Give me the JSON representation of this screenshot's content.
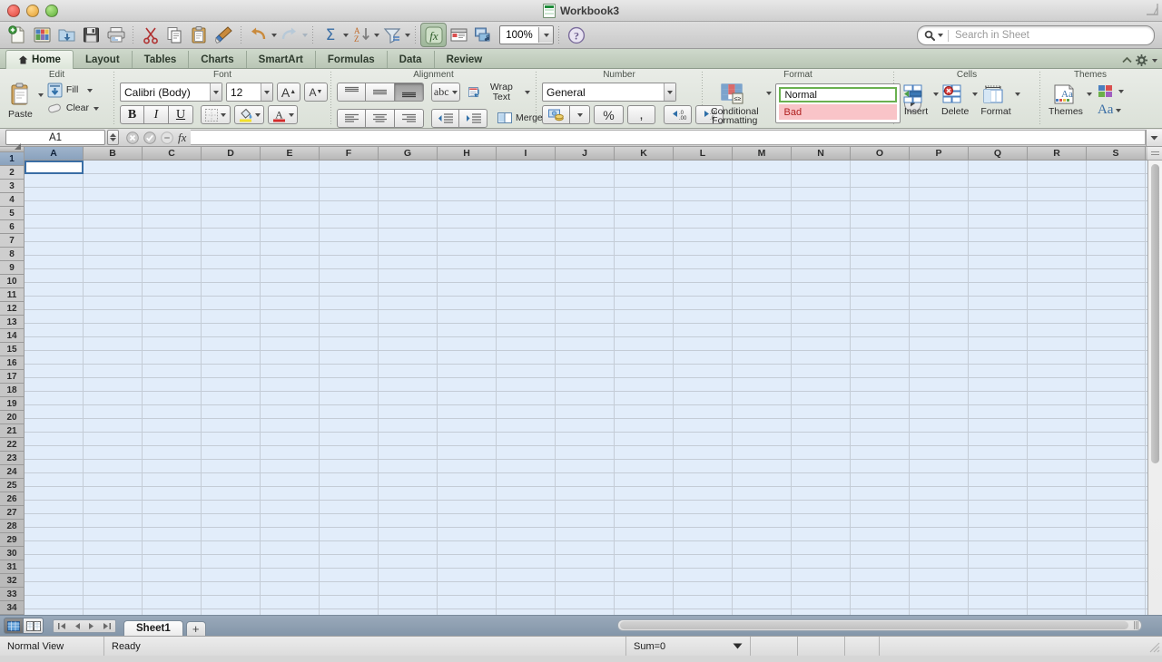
{
  "window": {
    "title": "Workbook3",
    "doc_icon": "spreadsheet-icon",
    "traffic_lights": [
      "close",
      "minimize",
      "zoom"
    ]
  },
  "toolbar": {
    "items": [
      {
        "name": "new-workbook",
        "icon": "new-document-icon",
        "label": "New"
      },
      {
        "name": "open-recent",
        "icon": "open-gallery-icon",
        "label": "Open"
      },
      {
        "name": "open",
        "icon": "open-folder-icon",
        "label": "Open"
      },
      {
        "name": "save",
        "icon": "save-disk-icon",
        "label": "Save"
      },
      {
        "name": "print",
        "icon": "printer-icon",
        "label": "Print"
      },
      {
        "name": "cut",
        "icon": "scissors-icon",
        "label": "Cut"
      },
      {
        "name": "copy",
        "icon": "copy-icon",
        "label": "Copy"
      },
      {
        "name": "paste",
        "icon": "clipboard-icon",
        "label": "Paste"
      },
      {
        "name": "format-painter",
        "icon": "paintbrush-icon",
        "label": "Format"
      },
      {
        "name": "undo",
        "icon": "undo-arrow-icon",
        "label": "Undo"
      },
      {
        "name": "redo",
        "icon": "redo-arrow-icon",
        "label": "Redo"
      },
      {
        "name": "autosum",
        "icon": "sigma-icon",
        "label": "AutoSum"
      },
      {
        "name": "sort",
        "icon": "sort-az-icon",
        "label": "Sort"
      },
      {
        "name": "filter",
        "icon": "funnel-icon",
        "label": "Filter"
      },
      {
        "name": "formula-builder",
        "icon": "fx-icon",
        "label": "Formula Builder"
      },
      {
        "name": "toolbox",
        "icon": "toolbox-icon",
        "label": "Toolbox"
      },
      {
        "name": "media-browser",
        "icon": "media-browser-icon",
        "label": "Media Browser"
      }
    ],
    "zoom": {
      "value": "100%",
      "icon": "chevron-down-icon"
    },
    "help": {
      "icon": "help-question-icon",
      "label": "Help"
    }
  },
  "search": {
    "placeholder": "Search in Sheet",
    "value": "",
    "icon": "search-icon",
    "dropdown_icon": "chevron-down-icon"
  },
  "ribbon": {
    "tabs": [
      {
        "id": "home",
        "label": "Home",
        "icon": "home-icon",
        "active": true
      },
      {
        "id": "layout",
        "label": "Layout",
        "active": false
      },
      {
        "id": "tables",
        "label": "Tables",
        "active": false
      },
      {
        "id": "charts",
        "label": "Charts",
        "active": false
      },
      {
        "id": "smartart",
        "label": "SmartArt",
        "active": false
      },
      {
        "id": "formulas",
        "label": "Formulas",
        "active": false
      },
      {
        "id": "data",
        "label": "Data",
        "active": false
      },
      {
        "id": "review",
        "label": "Review",
        "active": false
      }
    ],
    "collapse_icon": "chevron-up-icon",
    "settings_icon": "gear-icon",
    "groups": {
      "edit": {
        "title": "Edit",
        "paste": "Paste",
        "fill": "Fill",
        "clear": "Clear"
      },
      "font": {
        "title": "Font",
        "font_name": "Calibri (Body)",
        "font_size": "12",
        "grow_label": "A",
        "shrink_label": "A",
        "bold": "B",
        "italic": "I",
        "underline": "U",
        "borders_icon": "borders-icon",
        "fill_color_icon": "fill-color-icon",
        "font_color_icon": "font-color-icon"
      },
      "alignment": {
        "title": "Alignment",
        "align_top": "align-top-icon",
        "align_middle": "align-middle-icon",
        "align_bottom": "align-bottom-icon",
        "orientation": "abc",
        "wrap_text": "Wrap Text",
        "align_left": "align-left-icon",
        "align_center": "align-center-icon",
        "align_right": "align-right-icon",
        "decrease_indent": "decrease-indent-icon",
        "increase_indent": "increase-indent-icon",
        "merge": "Merge"
      },
      "number": {
        "title": "Number",
        "format": "General",
        "currency_icon": "currency-icon",
        "percent": "%",
        "comma": ",",
        "decrease_decimal": "decrease-decimal-icon",
        "increase_decimal": "increase-decimal-icon"
      },
      "format": {
        "title": "Format",
        "conditional_formatting": "Conditional Formatting",
        "styles": [
          {
            "label": "Normal",
            "selected": true
          },
          {
            "label": "Bad",
            "selected": false
          }
        ],
        "more_icon": "gallery-more-icon"
      },
      "cells": {
        "title": "Cells",
        "insert": "Insert",
        "delete": "Delete",
        "format": "Format"
      },
      "themes": {
        "title": "Themes",
        "themes": "Themes",
        "colors_icon": "theme-colors-icon",
        "fonts_label": "Aa"
      }
    }
  },
  "formula_bar": {
    "name_box": "A1",
    "formula": "",
    "cancel_icon": "cancel-x-icon",
    "confirm_icon": "confirm-check-icon",
    "function_icon": "fx-icon",
    "expand_icon": "chevron-down-icon"
  },
  "grid": {
    "columns": [
      "A",
      "B",
      "C",
      "D",
      "E",
      "F",
      "G",
      "H",
      "I",
      "J",
      "K",
      "L",
      "M",
      "N",
      "O",
      "P",
      "Q",
      "R",
      "S"
    ],
    "rows": [
      1,
      2,
      3,
      4,
      5,
      6,
      7,
      8,
      9,
      10,
      11,
      12,
      13,
      14,
      15,
      16,
      17,
      18,
      19,
      20,
      21,
      22,
      23,
      24,
      25,
      26,
      27,
      28,
      29,
      30,
      31,
      32,
      33,
      34
    ],
    "active_cell": "A1",
    "active_col_index": 0,
    "active_row_index": 0,
    "cell_bg": "#e2edfa",
    "active_cell_bg": "#ffffff",
    "selection_color": "#3a6ea5"
  },
  "sheet_bar": {
    "view_normal_icon": "normal-view-icon",
    "view_layout_icon": "page-layout-view-icon",
    "nav_first_icon": "first-sheet-icon",
    "nav_prev_icon": "previous-sheet-icon",
    "nav_next_icon": "next-sheet-icon",
    "nav_last_icon": "last-sheet-icon",
    "sheets": [
      {
        "label": "Sheet1",
        "active": true
      }
    ],
    "add_sheet_label": "+"
  },
  "status_bar": {
    "view_mode": "Normal View",
    "state": "Ready",
    "sum": "Sum=0",
    "sum_dropdown_icon": "chevron-down-icon"
  }
}
